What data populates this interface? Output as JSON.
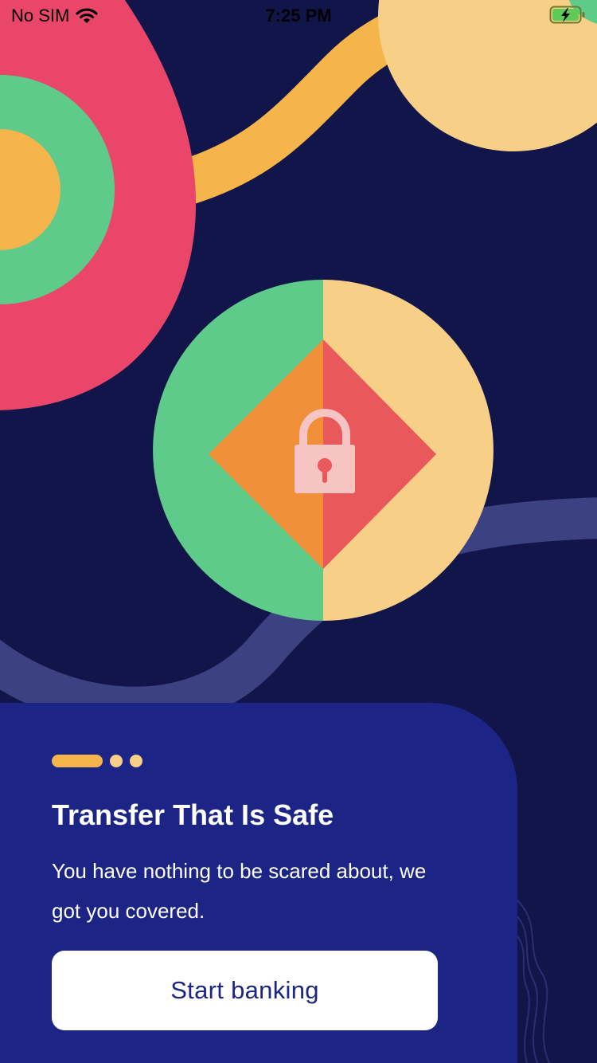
{
  "status_bar": {
    "carrier": "No SIM",
    "time": "7:25 PM",
    "wifi_icon": "wifi-icon",
    "battery_icon": "battery-charging-icon"
  },
  "onboarding": {
    "page_indicator": {
      "total": 3,
      "active_index": 0
    },
    "title": "Transfer That Is Safe",
    "description": "You have nothing to be scared about, we got you covered.",
    "cta_label": "Start banking"
  },
  "illustration": {
    "center_icon": "lock-icon"
  },
  "colors": {
    "background": "#11154a",
    "card": "#1c2585",
    "pink": "#e9466a",
    "green": "#5ecb8b",
    "amber": "#f5b54a",
    "cream": "#f7cf87",
    "orange": "#f08f37",
    "coral": "#e9585b",
    "lock": "#f7c4c4",
    "ribbon": "#3c4181",
    "button_text": "#1c2585"
  }
}
